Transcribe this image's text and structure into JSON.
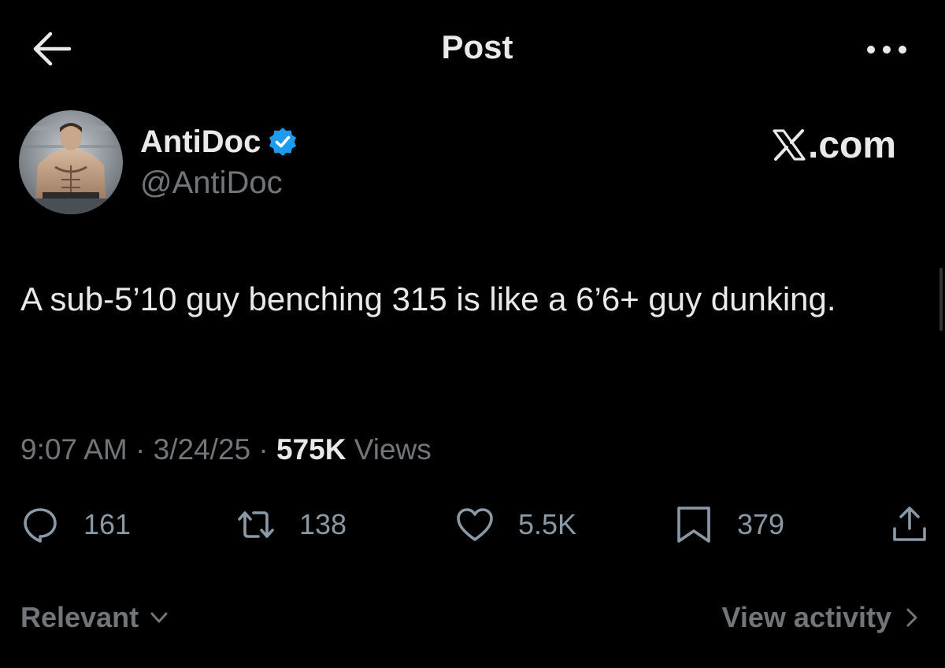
{
  "header": {
    "title": "Post",
    "back_icon": "arrow-left-icon",
    "more_icon": "more-horizontal-icon"
  },
  "author": {
    "display_name": "AntiDoc",
    "handle": "@AntiDoc",
    "verified": true,
    "verified_color": "#1d9bf0"
  },
  "watermark": {
    "text": ".com"
  },
  "post": {
    "text": "A sub-5’10 guy benching 315 is like a 6’6+ guy dunking."
  },
  "meta": {
    "time": "9:07 AM",
    "separator": " · ",
    "date": "3/24/25",
    "views_count": "575K",
    "views_label": "Views"
  },
  "actions": {
    "reply": {
      "icon": "reply-icon",
      "count": "161"
    },
    "repost": {
      "icon": "repost-icon",
      "count": "138"
    },
    "like": {
      "icon": "heart-icon",
      "count": "5.5K"
    },
    "bookmark": {
      "icon": "bookmark-icon",
      "count": "379"
    },
    "share": {
      "icon": "share-icon"
    }
  },
  "footer": {
    "sort_label": "Relevant",
    "activity_label": "View activity"
  },
  "colors": {
    "background": "#000000",
    "primary_text": "#e7e9ea",
    "secondary_text": "#71767b",
    "accent": "#1d9bf0"
  }
}
